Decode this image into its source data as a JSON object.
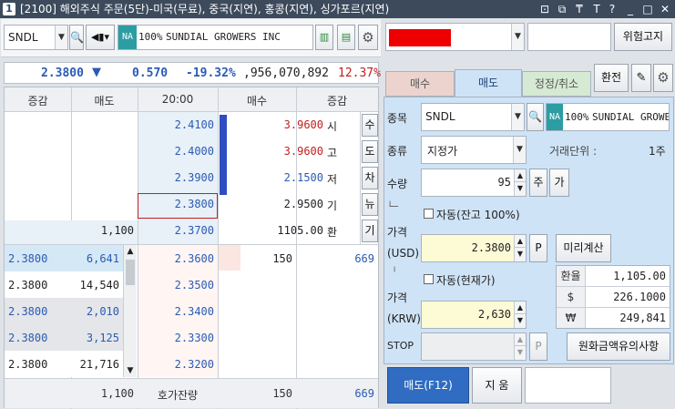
{
  "window": {
    "number": "1",
    "title": "[2100] 해외주식 주문(5단)-미국(무료), 중국(지연), 홍콩(지연), 싱가포르(지연)",
    "controls": [
      "⊡",
      "⧉",
      "₸",
      "T",
      "?",
      "_",
      "□",
      "✕"
    ]
  },
  "left_toolbar": {
    "symbol": "SNDL",
    "na_badge": "NA",
    "percent": "100%",
    "stock_name": "SUNDIAL GROWERS INC"
  },
  "quote_bar": {
    "price": "2.3800",
    "arrow": "▼",
    "change": "0.570",
    "change_pct": "-19.32%",
    "volume": ",956,070,892",
    "ratio": "12.37%"
  },
  "orderbook": {
    "headers": {
      "change": "증감",
      "ask": "매도",
      "time": "20:00",
      "bid": "매수",
      "change2": "증감"
    },
    "asks": [
      {
        "price": "2.4100",
        "ask_qty": "",
        "info_value": "3.9600",
        "info_label": "시",
        "side": "시"
      },
      {
        "price": "2.4000",
        "ask_qty": "",
        "info_value": "3.9600",
        "info_label": "고",
        "side": "도"
      },
      {
        "price": "2.3900",
        "ask_qty": "",
        "info_value": "2.1500",
        "info_label": "저",
        "side": "차"
      },
      {
        "price": "2.3800",
        "ask_qty": "",
        "info_value": "2.9500",
        "info_label": "기",
        "side": "뉴"
      },
      {
        "price": "2.3700",
        "ask_qty": "1,100",
        "info_value": "1105.00",
        "info_label": "환",
        "side": "기"
      }
    ],
    "side_buttons": [
      "수",
      "도",
      "차",
      "뉴",
      "기"
    ],
    "bids": [
      {
        "price": "2.3600",
        "bid_qty": "150",
        "change2": "669"
      },
      {
        "price": "2.3500",
        "bid_qty": "",
        "change2": ""
      },
      {
        "price": "2.3400",
        "bid_qty": "",
        "change2": ""
      },
      {
        "price": "2.3300",
        "bid_qty": "",
        "change2": ""
      },
      {
        "price": "2.3200",
        "bid_qty": "",
        "change2": ""
      }
    ],
    "trades": [
      {
        "price": "2.3800",
        "qty": "6,641"
      },
      {
        "price": "2.3800",
        "qty": "14,540"
      },
      {
        "price": "2.3800",
        "qty": "2,010"
      },
      {
        "price": "2.3800",
        "qty": "3,125"
      },
      {
        "price": "2.3800",
        "qty": "21,716"
      }
    ],
    "footer": {
      "ask_total": "1,100",
      "label": "호가잔량",
      "bid_total": "150",
      "change2": "669"
    }
  },
  "right_top": {
    "account": "",
    "account_color": "#ee0000",
    "password_placeholder": "",
    "risk_button": "위험고지"
  },
  "tabs": [
    {
      "label": "매수"
    },
    {
      "label": "매도"
    },
    {
      "label": "정정/취소"
    }
  ],
  "exchange_button": "환전",
  "order_form": {
    "symbol_label": "종목",
    "symbol": "SNDL",
    "na_badge": "NA",
    "percent": "100%",
    "stock_name": "SUNDIAL GROWERS INC",
    "type_label": "종류",
    "type_value": "지정가",
    "unit_label": "거래단위 :",
    "unit_value": "1주",
    "qty_label": "수량",
    "qty_value": "95",
    "qty_unit": "주",
    "qty_possible": "가",
    "auto_balance_label": "자동(잔고 100%)",
    "price_usd_label1": "가격",
    "price_usd_label2": "(USD)",
    "price_usd": "2.3800",
    "p_button": "P",
    "precalc_button": "미리계산",
    "auto_current_label": "자동(현재가)",
    "price_krw_label1": "가격",
    "price_krw_label2": "(KRW)",
    "price_krw": "2,630",
    "stop_label": "STOP",
    "stop_value": "",
    "fx_table": [
      {
        "label": "환율",
        "value": "1,105.00"
      },
      {
        "label": "$",
        "value": "226.1000"
      },
      {
        "label": "₩",
        "value": "249,841"
      }
    ],
    "fx_notice_button": "원화금액유의사항",
    "sell_button": "매도(F12)",
    "clear_button": "지 움",
    "message": ""
  }
}
